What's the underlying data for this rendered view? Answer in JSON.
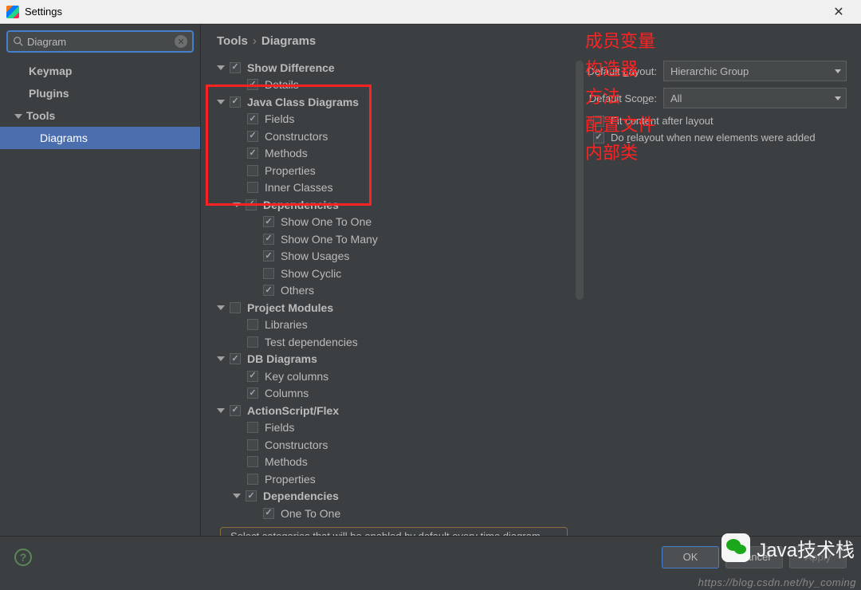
{
  "titlebar": {
    "title": "Settings"
  },
  "search": {
    "value": "Diagram"
  },
  "nav": {
    "keymap": "Keymap",
    "plugins": "Plugins",
    "tools": "Tools",
    "diagrams": "Diagrams"
  },
  "breadcrumb": {
    "a": "Tools",
    "sep": "›",
    "b": "Diagrams"
  },
  "tree": {
    "show_difference": "Show Difference",
    "details": "Details",
    "java_class_diagrams": "Java Class Diagrams",
    "fields": "Fields",
    "constructors": "Constructors",
    "methods": "Methods",
    "properties": "Properties",
    "inner_classes": "Inner Classes",
    "dependencies": "Dependencies",
    "show_one_to_one": "Show One To One",
    "show_one_to_many": "Show One To Many",
    "show_usages": "Show Usages",
    "show_cyclic": "Show Cyclic",
    "others": "Others",
    "project_modules": "Project Modules",
    "libraries": "Libraries",
    "test_dependencies": "Test dependencies",
    "db_diagrams": "DB Diagrams",
    "key_columns": "Key columns",
    "columns": "Columns",
    "actionscript_flex": "ActionScript/Flex",
    "as_fields": "Fields",
    "as_constructors": "Constructors",
    "as_methods": "Methods",
    "as_properties": "Properties",
    "as_dependencies": "Dependencies",
    "one_to_one": "One To One"
  },
  "annotations": {
    "a1": "成员变量",
    "a2": "构造器",
    "a3": "方法",
    "a4": "配置文件",
    "a5": "内部类"
  },
  "options": {
    "default_layout_label_pre": "Default ",
    "default_layout_label_mn": "L",
    "default_layout_label_post": "ayout:",
    "default_layout_value": "Hierarchic Group",
    "default_scope_label_pre": "Default Sco",
    "default_scope_label_mn": "p",
    "default_scope_label_post": "e:",
    "default_scope_value": "All",
    "fit_content_mn": "F",
    "fit_content_post": "it content after layout",
    "do_relayout_pre": "Do ",
    "do_relayout_mn": "r",
    "do_relayout_post": "elayout when new elements were added"
  },
  "hint": "Select categories that will be enabled by default every time diagram appears",
  "buttons": {
    "ok": "OK",
    "cancel": "Cancel",
    "apply": "Apply"
  },
  "watermark": {
    "text": "Java技术栈",
    "url": "https://blog.csdn.net/hy_coming"
  }
}
